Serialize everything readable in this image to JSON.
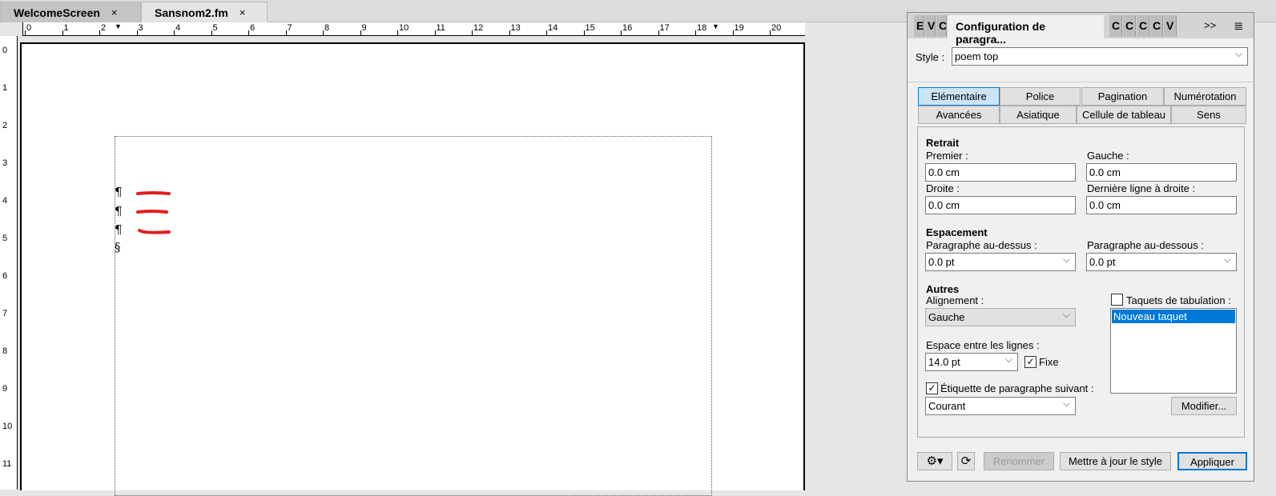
{
  "doc_tabs": [
    {
      "label": "WelcomeScreen",
      "close": "×"
    },
    {
      "label": "Sansnom2.fm",
      "close": "×"
    }
  ],
  "ruler_h": [
    "0",
    "1",
    "2",
    "3",
    "4",
    "5",
    "6",
    "7",
    "8",
    "9",
    "10",
    "11",
    "12",
    "13",
    "14",
    "15",
    "16",
    "17",
    "18",
    "19",
    "20"
  ],
  "ruler_v": [
    "0",
    "1",
    "2",
    "3",
    "4",
    "5",
    "6",
    "7",
    "8",
    "9",
    "10",
    "11"
  ],
  "doc": {
    "marks": [
      "¶",
      "¶",
      "¶",
      "§"
    ],
    "annotation_color": "#e02020"
  },
  "panel": {
    "title": "Configuration de paragra...",
    "collapsed_tabs_left": [
      "E",
      "V",
      "C"
    ],
    "collapsed_tabs_right": [
      "C",
      "C",
      "C",
      "C",
      "V"
    ],
    "overflow": ">>",
    "style_label": "Style :",
    "style_value": "poem top",
    "tabs_row1": [
      "Elémentaire",
      "Police",
      "Pagination",
      "Numérotation"
    ],
    "tabs_row2": [
      "Avancées",
      "Asiatique",
      "Cellule de tableau",
      "Sens"
    ],
    "retrait": {
      "heading": "Retrait",
      "premier_label": "Premier :",
      "premier": "0.0 cm",
      "gauche_label": "Gauche :",
      "gauche": "0.0 cm",
      "droite_label": "Droite :",
      "droite": "0.0 cm",
      "derniere_label": "Dernière ligne à droite :",
      "derniere": "0.0 cm"
    },
    "espacement": {
      "heading": "Espacement",
      "dessus_label": "Paragraphe au-dessus :",
      "dessus": "0.0 pt",
      "dessous_label": "Paragraphe au-dessous :",
      "dessous": "0.0 pt"
    },
    "autres": {
      "heading": "Autres",
      "alignement_label": "Alignement :",
      "alignement": "Gauche",
      "interligne_label": "Espace entre les lignes :",
      "interligne": "14.0 pt",
      "fixe_label": "Fixe",
      "fixe_checked": true,
      "suivant_label": "Étiquette de paragraphe suivant :",
      "suivant_checked": true,
      "suivant": "Courant"
    },
    "tabs_stops": {
      "label": "Taquets de tabulation :",
      "checked": false,
      "items": [
        "Nouveau taquet"
      ],
      "modifier": "Modifier..."
    },
    "buttons": {
      "rename": "Renommer",
      "update": "Mettre à jour le style",
      "apply": "Appliquer"
    }
  }
}
